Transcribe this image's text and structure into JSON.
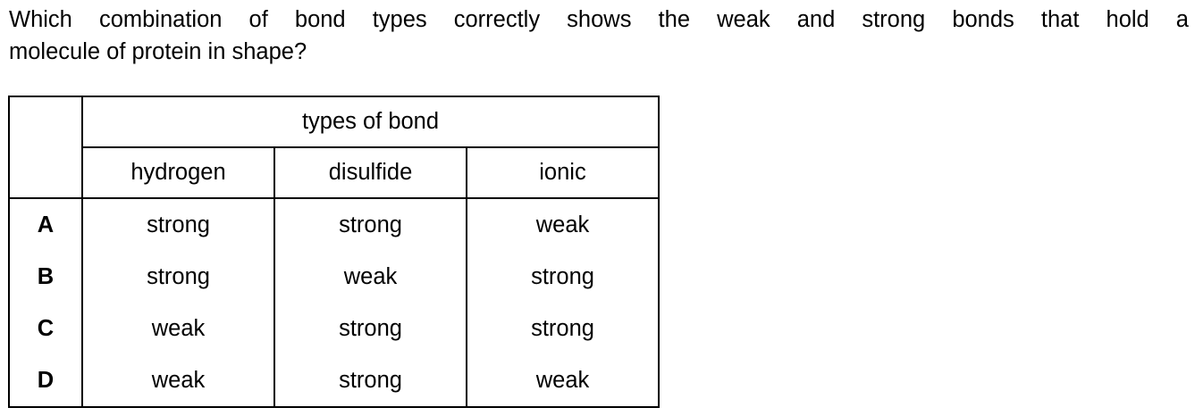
{
  "question": {
    "line1": "Which combination of bond types correctly shows the weak and strong bonds that hold a",
    "line2": "molecule of protein in shape?"
  },
  "table": {
    "group_header": "types of bond",
    "columns": [
      "hydrogen",
      "disulfide",
      "ionic"
    ],
    "rows": [
      {
        "letter": "A",
        "values": [
          "strong",
          "strong",
          "weak"
        ]
      },
      {
        "letter": "B",
        "values": [
          "strong",
          "weak",
          "strong"
        ]
      },
      {
        "letter": "C",
        "values": [
          "weak",
          "strong",
          "strong"
        ]
      },
      {
        "letter": "D",
        "values": [
          "weak",
          "strong",
          "weak"
        ]
      }
    ]
  }
}
